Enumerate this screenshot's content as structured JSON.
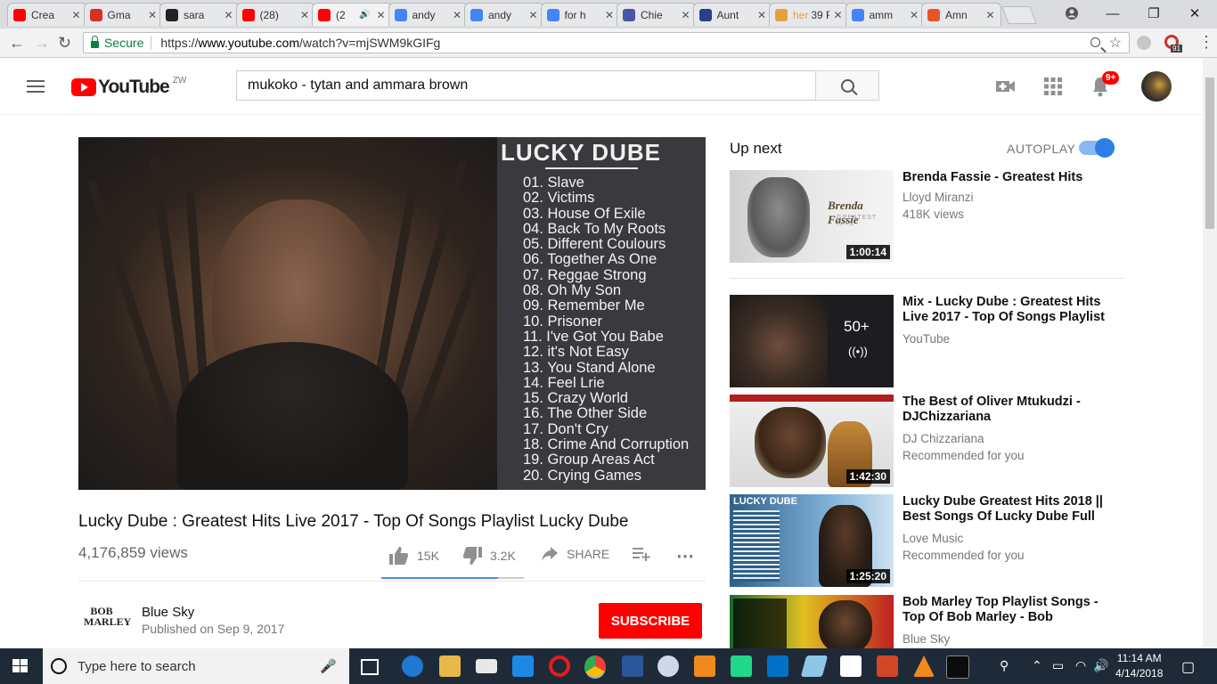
{
  "browser": {
    "tabs": [
      {
        "title": "Crea",
        "favicon": "youtube-icon",
        "color": "#ff0000"
      },
      {
        "title": "Gma",
        "favicon": "gmail-icon",
        "color": "#d93025"
      },
      {
        "title": "sara",
        "favicon": "github-icon",
        "color": "#222222"
      },
      {
        "title": "(28)",
        "favicon": "youtube-icon",
        "color": "#ff0000"
      },
      {
        "title": "(2",
        "favicon": "youtube-icon",
        "color": "#ff0000",
        "audio": "🔊"
      },
      {
        "title": "andy",
        "favicon": "google-icon",
        "color": "#4285f4"
      },
      {
        "title": "andy",
        "favicon": "google-icon",
        "color": "#4285f4"
      },
      {
        "title": "for h",
        "favicon": "google-icon",
        "color": "#4285f4"
      },
      {
        "title": "Chie",
        "favicon": "guitar-icon",
        "color": "#4a56a8"
      },
      {
        "title": "Aunt",
        "favicon": "s-icon",
        "color": "#2a3f8f"
      },
      {
        "title": "39 F",
        "favicon": "her-icon",
        "color": "#e8a03a",
        "prefix": "her"
      },
      {
        "title": "amm",
        "favicon": "google-icon",
        "color": "#4285f4"
      },
      {
        "title": "Amn",
        "favicon": "fire-icon",
        "color": "#e8542a"
      }
    ],
    "secure_label": "Secure",
    "url_prefix": "https://",
    "url_host": "www.youtube.com",
    "url_path": "/watch?v=mjSWM9kGIFg",
    "ext_badge": "91"
  },
  "youtube": {
    "logo_text": "YouTube",
    "country": "ZW",
    "search_value": "mukoko - tytan and ammara brown",
    "notif_badge": "9+"
  },
  "video": {
    "thumbnail_title": "LUCKY DUBE",
    "tracks": [
      "01. Slave",
      "02.  Victims",
      "03. House Of Exile",
      "04. Back To My Roots",
      "05. Different Coulours",
      "06. Together As One",
      "07. Reggae Strong",
      "08. Oh My Son",
      "09. Remember Me",
      "10. Prisoner",
      "11. I've Got You Babe",
      "12. it's Not Easy",
      "13. You Stand Alone",
      "14. Feel Lrie",
      "15. Crazy World",
      "16. The Other Side",
      "17. Don't Cry",
      "18. Crime And Corruption",
      "19. Group Areas Act",
      "20. Crying Games"
    ],
    "title": "Lucky Dube : Greatest Hits Live 2017 - Top Of Songs Playlist Lucky Dube",
    "views": "4,176,859 views",
    "likes": "15K",
    "dislikes": "3.2K",
    "share_label": "SHARE",
    "like_ratio": 0.82,
    "channel": "Blue Sky",
    "channel_logo_text": "BOB MARLEY",
    "published": "Published on Sep 9, 2017",
    "subscribe_label": "SUBSCRIBE"
  },
  "sidebar": {
    "upnext_label": "Up next",
    "autoplay_label": "AUTOPLAY",
    "autoplay_on": true,
    "items": [
      {
        "title": "Brenda Fassie - Greatest Hits",
        "channel": "Lloyd Miranzi",
        "meta": "418K views",
        "duration": "1:00:14",
        "thumb_text": "Brenda Fassie",
        "thumb_sub": "GREATEST HITS"
      },
      {
        "title": "Mix - Lucky Dube : Greatest Hits Live 2017 - Top Of Songs Playlist",
        "channel": "YouTube",
        "meta": "",
        "duration": "",
        "mix_count": "50+"
      },
      {
        "title": "The Best of Oliver Mtukudzi - DJChizzariana",
        "channel": "DJ Chizzariana",
        "meta": "Recommended for you",
        "duration": "1:42:30"
      },
      {
        "title": "Lucky Dube Greatest Hits 2018 || Best Songs Of Lucky Dube Full",
        "channel": "Love Music",
        "meta": "Recommended for you",
        "duration": "1:25:20",
        "thumb_text": "LUCKY DUBE"
      },
      {
        "title": "Bob Marley Top Playlist Songs - Top Of Bob Marley - Bob",
        "channel": "Blue Sky",
        "meta": "",
        "duration": ""
      }
    ]
  },
  "taskbar": {
    "search_placeholder": "Type here to search",
    "time": "11:14 AM",
    "date": "4/14/2018"
  }
}
